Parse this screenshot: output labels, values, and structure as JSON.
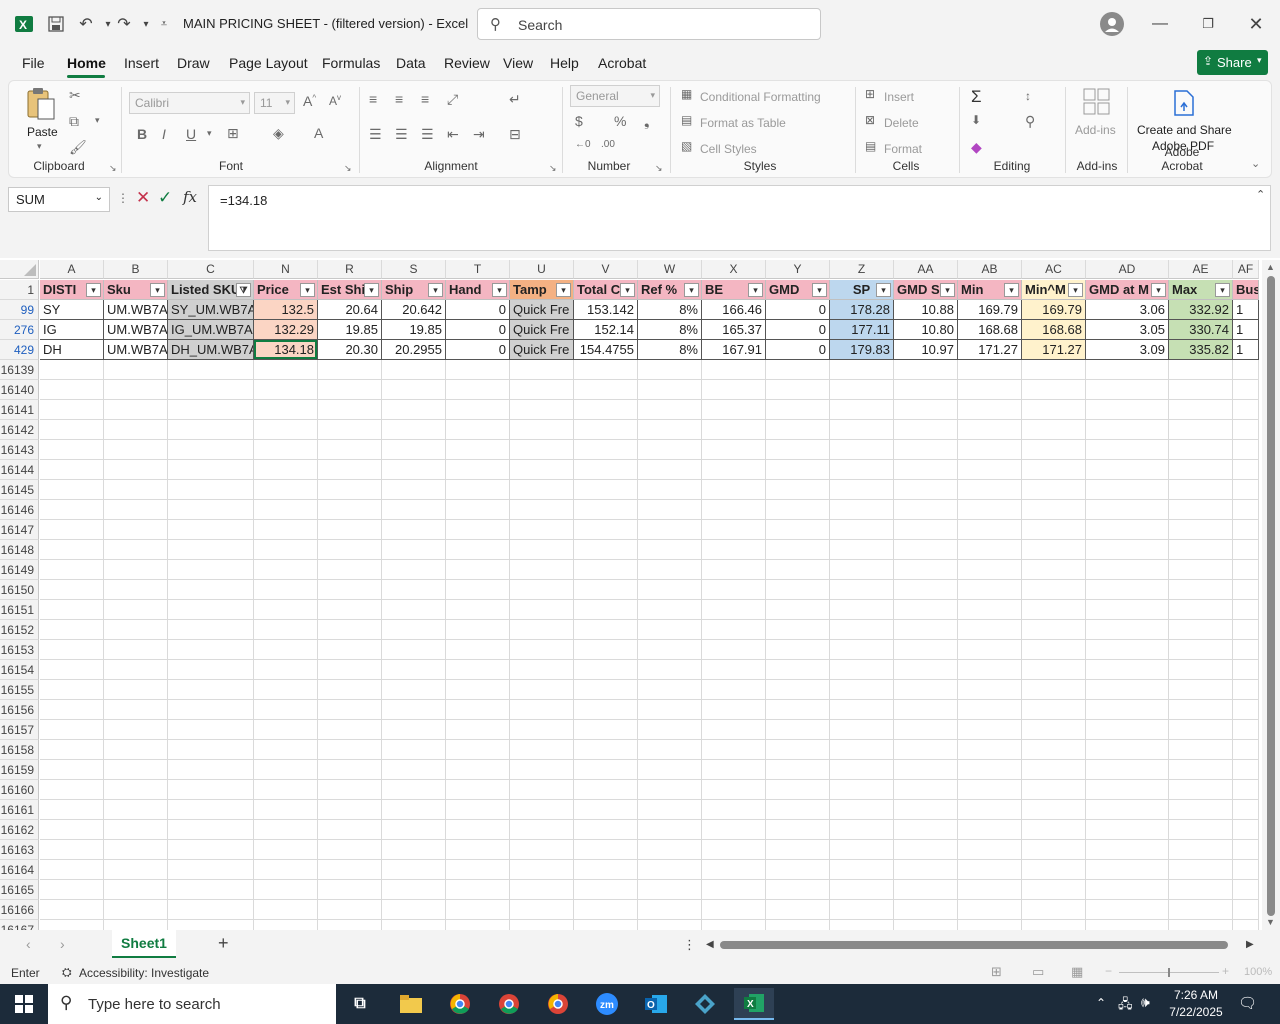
{
  "window": {
    "title": "MAIN PRICING SHEET - (filtered version)  -  Excel",
    "search_placeholder": "Search",
    "excel_icon": "excel-icon",
    "controls": [
      "minimize-icon",
      "restore-icon",
      "close-icon"
    ]
  },
  "ribbon_tabs": [
    "File",
    "Home",
    "Insert",
    "Draw",
    "Page Layout",
    "Formulas",
    "Data",
    "Review",
    "View",
    "Help",
    "Acrobat"
  ],
  "active_tab": "Home",
  "share_label": "Share",
  "ribbon": {
    "clipboard": {
      "paste_label": "Paste",
      "group_label": "Clipboard"
    },
    "font": {
      "font_name": "Calibri",
      "font_size": "11",
      "group_label": "Font"
    },
    "alignment": {
      "group_label": "Alignment"
    },
    "number": {
      "format": "General",
      "group_label": "Number"
    },
    "styles": {
      "conditional_formatting": "Conditional Formatting",
      "format_as_table": "Format as Table",
      "cell_styles": "Cell Styles",
      "group_label": "Styles"
    },
    "cells": {
      "insert": "Insert",
      "delete": "Delete",
      "format": "Format",
      "group_label": "Cells"
    },
    "editing": {
      "group_label": "Editing"
    },
    "addins": {
      "label": "Add-ins",
      "group_label": "Add-ins"
    },
    "acrobat": {
      "create_share_line1": "Create and Share",
      "create_share_line2": "Adobe PDF",
      "group_label": "Adobe Acrobat"
    }
  },
  "formula_bar": {
    "name_box": "SUM",
    "formula": "=134.18"
  },
  "columns": [
    "A",
    "B",
    "C",
    "N",
    "R",
    "S",
    "T",
    "U",
    "V",
    "W",
    "X",
    "Y",
    "Z",
    "AA",
    "AB",
    "AC",
    "AD",
    "AE",
    "AF"
  ],
  "column_headers_visible": [
    "A",
    "B",
    "C",
    "N",
    "R",
    "S",
    "T",
    "U",
    "V",
    "W",
    "X",
    "Y",
    "Z",
    "AA",
    "AB",
    "AC",
    "AD",
    "AE"
  ],
  "header_row": {
    "row_number": "1",
    "cells": [
      "DISTI",
      "Sku",
      "Listed SKU",
      "Price",
      "Est Ship",
      "Ship",
      "Hand",
      "Tamp",
      "Total C",
      "Ref %",
      "BE",
      "GMD",
      "SP",
      "GMD S",
      "Min",
      "Min^M",
      "GMD at M",
      "Max",
      "Bus"
    ]
  },
  "data_rows": [
    {
      "row_number": "99",
      "cells": [
        "SY",
        "UM.WB7A",
        "SY_UM.WB7A",
        "132.5",
        "20.64",
        "20.642",
        "0",
        "Quick Fre",
        "153.142",
        "8%",
        "166.46",
        "0",
        "178.28",
        "10.88",
        "169.79",
        "169.79",
        "3.06",
        "332.92",
        "1"
      ]
    },
    {
      "row_number": "276",
      "cells": [
        "IG",
        "UM.WB7A",
        "IG_UM.WB7A",
        "132.29",
        "19.85",
        "19.85",
        "0",
        "Quick Fre",
        "152.14",
        "8%",
        "165.37",
        "0",
        "177.11",
        "10.80",
        "168.68",
        "168.68",
        "3.05",
        "330.74",
        "1"
      ]
    },
    {
      "row_number": "429",
      "cells": [
        "DH",
        "UM.WB7A",
        "DH_UM.WB7A",
        "134.18",
        "20.30",
        "20.2955",
        "0",
        "Quick Fre",
        "154.4755",
        "8%",
        "167.91",
        "0",
        "179.83",
        "10.97",
        "171.27",
        "171.27",
        "3.09",
        "335.82",
        "1"
      ]
    }
  ],
  "empty_row_numbers": [
    "16139",
    "16140",
    "16141",
    "16142",
    "16143",
    "16144",
    "16145",
    "16146",
    "16147",
    "16148",
    "16149",
    "16150",
    "16151",
    "16152",
    "16153",
    "16154",
    "16155",
    "16156",
    "16157",
    "16158",
    "16159",
    "16160",
    "16161",
    "16162",
    "16163",
    "16164",
    "16165",
    "16166",
    "16167"
  ],
  "sheet_tabs": [
    "Sheet1"
  ],
  "status": {
    "mode": "Enter",
    "accessibility": "Accessibility: Investigate",
    "zoom": "100%"
  },
  "taskbar": {
    "search_placeholder": "Type here to search",
    "time": "7:26 AM",
    "date": "7/22/2025"
  },
  "colors": {
    "excel_green": "#107c41",
    "header_pink": "#f4b6c2",
    "price_peach": "#fbd5c4",
    "tamp_orange": "#f4b183",
    "sp_blue": "#bdd7ee",
    "min_yellow": "#fff2cc",
    "max_green": "#c6e0b4",
    "listed_grey": "#d0d0d0"
  }
}
